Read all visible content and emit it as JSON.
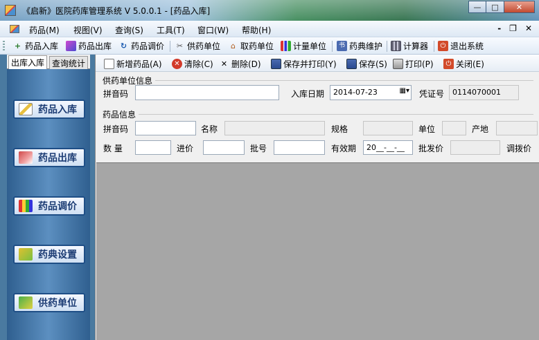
{
  "window": {
    "title": "《启新》医院药库管理系统 V 5.0.0.1 - [药品入库]",
    "min": "—",
    "max": "□",
    "close": "✕"
  },
  "menu": {
    "items": [
      "药品(M)",
      "视图(V)",
      "查询(S)",
      "工具(T)",
      "窗口(W)",
      "帮助(H)"
    ],
    "mdi_min": "-",
    "mdi_restore": "❐",
    "mdi_close": "✕"
  },
  "toolbar": {
    "items": [
      "药品入库",
      "药品出库",
      "药品调价",
      "供药单位",
      "取药单位",
      "计量单位",
      "药典维护",
      "计算器",
      "退出系统"
    ]
  },
  "left": {
    "tabs": [
      "出库入库",
      "查询统计"
    ],
    "nav": [
      "药品入库",
      "药品出库",
      "药品调价",
      "药典设置",
      "供药单位"
    ]
  },
  "form_toolbar": {
    "items": [
      "新增药品(A)",
      "清除(C)",
      "删除(D)",
      "保存并打印(Y)",
      "保存(S)",
      "打印(P)",
      "关闭(E)"
    ]
  },
  "supplier": {
    "group_title": "供药单位信息",
    "pinyin_label": "拼音码",
    "pinyin_value": "",
    "date_label": "入库日期",
    "date_value": "2014-07-23",
    "voucher_label": "凭证号",
    "voucher_value": "0114070001"
  },
  "drug": {
    "group_title": "药品信息",
    "pinyin_label": "拼音码",
    "name_label": "名称",
    "spec_label": "规格",
    "unit_label": "单位",
    "origin_label": "产地",
    "qty_label": "数  量",
    "price_label": "进价",
    "batch_label": "批号",
    "expiry_label": "有效期",
    "expiry_value": "20__-__-__",
    "wholesale_label": "批发价",
    "transfer_label": "调拨价"
  }
}
